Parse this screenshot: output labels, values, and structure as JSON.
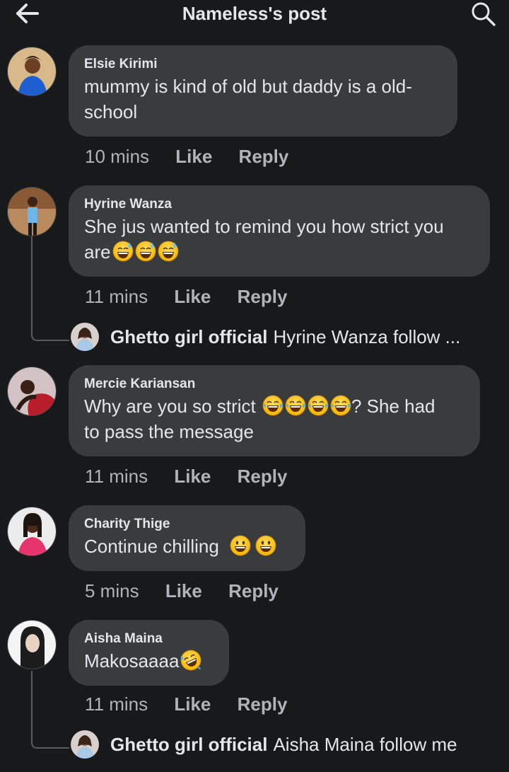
{
  "header": {
    "title": "Nameless's post",
    "back_icon": "arrow-left-icon",
    "search_icon": "search-icon"
  },
  "colors": {
    "background": "#18191a",
    "bubble": "#3a3b3c",
    "text_primary": "#e4e6eb",
    "text_secondary": "#b0b3b8"
  },
  "comments": [
    {
      "author": "Elsie Kirimi",
      "line1": "mummy is kind of old but daddy is a old-",
      "line2": "school",
      "time": "10 mins",
      "like": "Like",
      "reply": "Reply"
    },
    {
      "author": "Hyrine Wanza",
      "line1": "She jus wanted to remind you how strict you",
      "line2": "are",
      "emojis": [
        "grinning-sweat-emoji",
        "grinning-sweat-emoji",
        "grinning-sweat-emoji"
      ],
      "time": "11 mins",
      "like": "Like",
      "reply": "Reply",
      "reply_preview": {
        "name": "Ghetto girl official",
        "text": "Hyrine Wanza follow ..."
      }
    },
    {
      "author": "Mercie Kariansan",
      "line1_before": "Why are you so strict ",
      "line1_after": "? She had",
      "line2": "to pass the message",
      "emojis": [
        "tears-of-joy-emoji",
        "tears-of-joy-emoji",
        "tears-of-joy-emoji",
        "tears-of-joy-emoji"
      ],
      "time": "11 mins",
      "like": "Like",
      "reply": "Reply"
    },
    {
      "author": "Charity Thige",
      "line1": "Continue chilling ",
      "emojis": [
        "grinning-face-emoji",
        "grinning-face-emoji"
      ],
      "time": "5 mins",
      "like": "Like",
      "reply": "Reply"
    },
    {
      "author": "Aisha Maina",
      "line1": "Makosaaaa",
      "emojis": [
        "rolling-laughing-emoji"
      ],
      "time": "11 mins",
      "like": "Like",
      "reply": "Reply",
      "reply_preview": {
        "name": "Ghetto girl official",
        "text": "Aisha Maina follow me"
      }
    }
  ]
}
